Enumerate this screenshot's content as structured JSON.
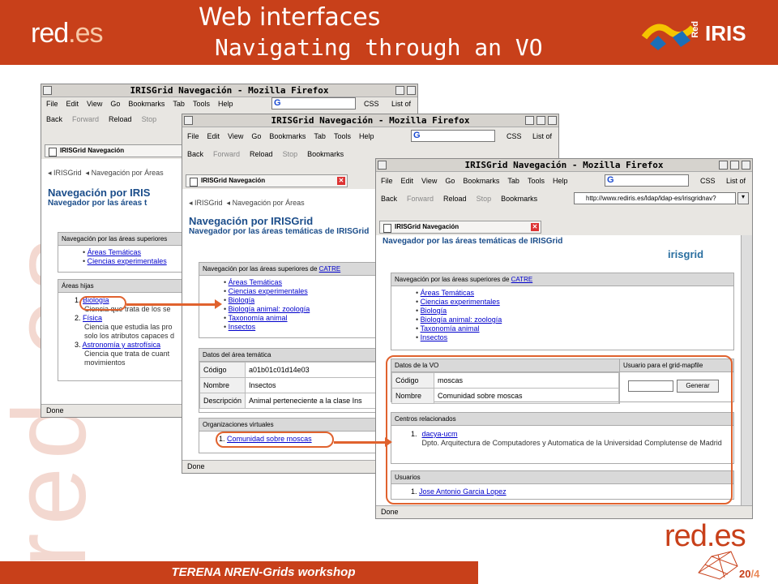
{
  "header": {
    "title": "Web interfaces",
    "subtitle": "Navigating through an VO",
    "logo_left": "red",
    "logo_left_dot": ".es",
    "logo_right": "IRIS",
    "logo_right_small": "Red"
  },
  "watermark": "red.es",
  "browser": {
    "title": "IRISGrid Navegación - Mozilla Firefox",
    "menu": [
      "File",
      "Edit",
      "View",
      "Go",
      "Bookmarks",
      "Tab",
      "Tools",
      "Help"
    ],
    "css_label": "CSS",
    "listof_label": "List of",
    "nav": {
      "back": "Back",
      "forward": "Forward",
      "reload": "Reload",
      "stop": "Stop",
      "bookmarks": "Bookmarks"
    },
    "url": "http://www.rediris.es/ldap/ldap-es/irisgridnav?",
    "tab": "IRISGrid Navegación",
    "status": "Done"
  },
  "page": {
    "crumb_home": "◂ IRISGrid",
    "crumb_areas": "◂ Navegación por Áreas",
    "heading": "Navegación por IRISGrid",
    "subheading": "Navegador por las áreas temáticas de IRISGrid",
    "logo": "irisgrid"
  },
  "win1": {
    "heading_cut": "Navegación por IRIS",
    "subheading_cut": "Navegador por las áreas t",
    "panel_sup": "Navegación por las áreas superiores",
    "sup_items": [
      "Áreas Temáticas",
      "Ciencias experimentales"
    ],
    "panel_hijas": "Áreas hijas",
    "hijas": [
      {
        "num": "1.",
        "link": "Biología",
        "desc": "Ciencia que trata de los se"
      },
      {
        "num": "2.",
        "link": "Física",
        "desc": "Ciencia que estudia las pro",
        "desc2": "solo los atributos capaces d"
      },
      {
        "num": "3.",
        "link": "Astronomía y astrofísica",
        "desc": "Ciencia que trata de cuant",
        "desc2": "movimientos"
      }
    ]
  },
  "win2": {
    "panel_sup_prefix": "Navegación por las áreas superiores de",
    "panel_sup_link": "CATRE",
    "sup_items": [
      "Áreas Temáticas",
      "Ciencias experimentales",
      "Biología",
      "Biología animal: zoología",
      "Taxonomía animal",
      "Insectos"
    ],
    "panel_datos": "Datos del área temática",
    "rows": [
      {
        "k": "Código",
        "v": "a01b01c01d14e03"
      },
      {
        "k": "Nombre",
        "v": "Insectos"
      },
      {
        "k": "Descripción",
        "v": "Animal perteneciente a la clase Ins"
      }
    ],
    "panel_org": "Organizaciones virtuales",
    "org_num": "1.",
    "org_link": "Comunidad sobre moscas"
  },
  "win3": {
    "url": "http://www.rediris.es/ldap/ldap-es/irisgridnav?",
    "panel_sup_prefix": "Navegación por las áreas superiores de",
    "panel_sup_link": "CATRE",
    "sup_items": [
      "Áreas Temáticas",
      "Ciencias experimentales",
      "Biología",
      "Biología animal: zoología",
      "Taxonomía animal",
      "Insectos"
    ],
    "panel_vo": "Datos de la VO",
    "panel_user": "Usuario para el grid-mapfile",
    "rows": [
      {
        "k": "Código",
        "v": "moscas"
      },
      {
        "k": "Nombre",
        "v": "Comunidad sobre moscas"
      }
    ],
    "generar": "Generar",
    "panel_centros": "Centros relacionados",
    "centro_num": "1.",
    "centro_link": "dacya-ucm",
    "centro_desc": "Dpto. Arquitectura de Computadores y Automatica de la Universidad Complutense de Madrid",
    "panel_usuarios": "Usuarios",
    "usuario_num": "1.",
    "usuario_link": "Jose Antonio Garcia Lopez"
  },
  "footer": {
    "text": "TERENA NREN-Grids workshop",
    "logo": "red",
    "logo_dot": ".es",
    "page": "20",
    "total": "/4"
  },
  "colors": {
    "brand": "#c8401a",
    "highlight": "#e0622e",
    "link": "#0000cc",
    "heading": "#1b4d8a"
  }
}
